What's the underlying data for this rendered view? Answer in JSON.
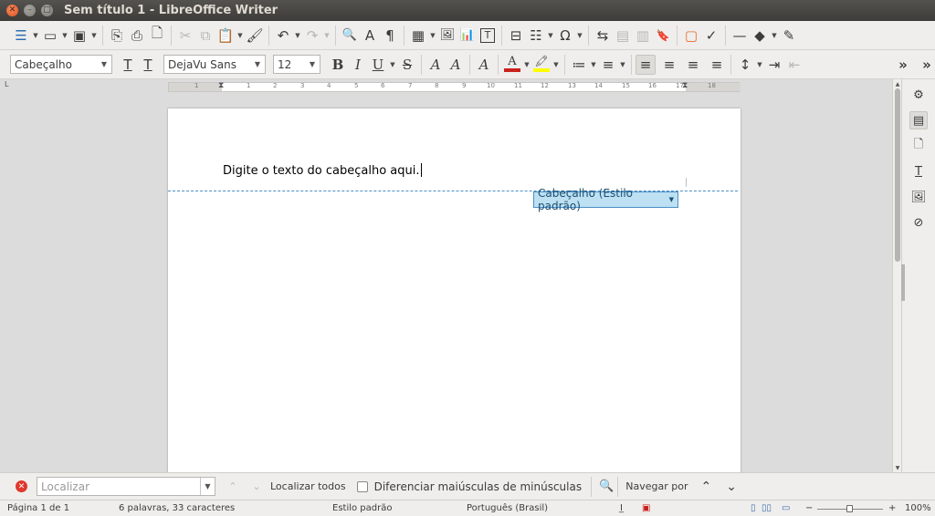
{
  "window": {
    "title": "Sem título 1 - LibreOffice Writer",
    "close_glyph": "✕",
    "minimize_glyph": "–",
    "maximize_glyph": "□"
  },
  "toolbar_standard": {
    "icons": {
      "view": "☰",
      "open": "▭",
      "save": "▣",
      "export_pdf": "⎘",
      "print": "⎙",
      "print_preview": "🗋",
      "cut": "✂",
      "copy": "⧉",
      "paste": "📋",
      "clone": "🖌",
      "undo": "↶",
      "redo": "↷",
      "find": "🔍",
      "spelling": "A",
      "formatting_marks": "¶",
      "table": "▦",
      "image": "🖼",
      "chart": "📊",
      "textbox": "T",
      "page_break": "⊟",
      "field": "☷",
      "special_char": "Ω",
      "hyperlink": "⇆",
      "footnote": "▤",
      "endnote": "▥",
      "bookmark": "🔖",
      "comment": "▢",
      "track_changes": "✓",
      "line": "—",
      "shapes": "◆",
      "draw": "✎"
    }
  },
  "toolbar_formatting": {
    "paragraph_style": "Cabeçalho",
    "font_name": "DejaVu Sans",
    "font_size": "12",
    "icons": {
      "style_update": "T",
      "style_new": "T",
      "bold": "B",
      "italic": "I",
      "underline": "U",
      "strike": "S",
      "superscript": "A",
      "subscript": "A",
      "clear_format": "A",
      "font_color": "A",
      "highlight": "ab",
      "bullets": "≔",
      "numbering": "≡",
      "align_left": "≡",
      "align_center": "≡",
      "align_right": "≡",
      "justify": "≡",
      "line_spacing": "↕",
      "indent_increase": "⇥",
      "indent_decrease": "⇤",
      "more": "»"
    },
    "colors": {
      "font_color": "#c9211e",
      "highlight": "#ffff00"
    }
  },
  "ruler": {
    "h_labels": [
      "1",
      "1",
      "2",
      "3",
      "4",
      "5",
      "6",
      "7",
      "8",
      "9",
      "10",
      "11",
      "12",
      "13",
      "14",
      "15",
      "16",
      "17",
      "18"
    ],
    "end_label": "L"
  },
  "document": {
    "header_text": "Digite o texto do cabeçalho aqui.",
    "header_tag": "Cabeçalho (Estilo padrão)",
    "header_tag_arrow": "▼"
  },
  "sidebar": {
    "icons": [
      "⚙",
      "▤",
      "🗋",
      "T",
      "🖼",
      "⊘"
    ]
  },
  "findbar": {
    "placeholder": "Localizar",
    "find_all": "Localizar todos",
    "match_case": "Diferenciar maiúsculas de minúsculas",
    "navigate_by": "Navegar por",
    "prev": "⌃",
    "next": "⌄",
    "search_icon": "🔍"
  },
  "statusbar": {
    "page": "Página 1 de 1",
    "words": "6 palavras, 33 caracteres",
    "style": "Estilo padrão",
    "language": "Português (Brasil)",
    "zoom": "100%",
    "zoom_minus": "−",
    "zoom_plus": "+"
  }
}
